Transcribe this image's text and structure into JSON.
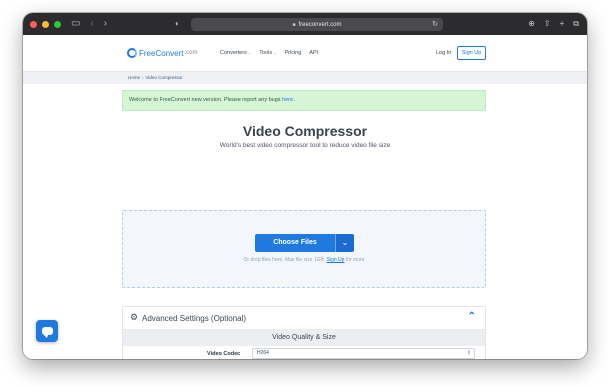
{
  "browser": {
    "url": "freeconvert.com",
    "icons": {
      "sidebar": "sidebar-icon",
      "back": "back-icon",
      "forward": "forward-icon",
      "privacy": "shield-icon",
      "reload": "reload-icon",
      "download": "download-icon",
      "share": "share-icon",
      "new_tab": "plus-icon",
      "tabs": "tabs-icon"
    }
  },
  "header": {
    "logo_text": "FreeConvert",
    "logo_suffix": ".com",
    "nav": [
      {
        "label": "Converters"
      },
      {
        "label": "Tools"
      },
      {
        "label": "Pricing"
      },
      {
        "label": "API"
      }
    ],
    "login": "Log In",
    "signup": "Sign Up"
  },
  "breadcrumb": {
    "home": "Home",
    "separator": "›",
    "current": "Video Compressor"
  },
  "notice": {
    "text": "Welcome to FreeConvert new version. Please report any bugs ",
    "link": "here.",
    "color": "#d6f5d6"
  },
  "page": {
    "title": "Video Compressor",
    "subtitle": "World's best video compressor tool to reduce video file size"
  },
  "upload": {
    "button": "Choose Files",
    "hint_prefix": "Or drop files here. Max file size 1GB. ",
    "hint_link": "Sign Up",
    "hint_suffix": " for more"
  },
  "advanced": {
    "title": "Advanced Settings (Optional)",
    "section": "Video Quality & Size",
    "codec_label": "Video Codec",
    "codec_value": "H264"
  },
  "colors": {
    "accent": "#1f7ae0",
    "chrome": "#2c2c2e"
  }
}
